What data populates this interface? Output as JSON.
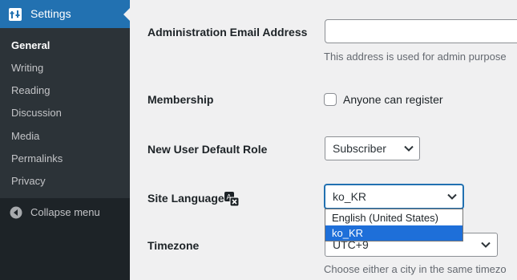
{
  "sidebar": {
    "menu_title": "Settings",
    "items": [
      {
        "label": "General",
        "current": true
      },
      {
        "label": "Writing"
      },
      {
        "label": "Reading"
      },
      {
        "label": "Discussion"
      },
      {
        "label": "Media"
      },
      {
        "label": "Permalinks"
      },
      {
        "label": "Privacy"
      }
    ],
    "collapse_label": "Collapse menu"
  },
  "form": {
    "admin_email": {
      "label": "Administration Email Address",
      "value": "",
      "description": "This address is used for admin purpose"
    },
    "membership": {
      "label": "Membership",
      "checkbox_label": "Anyone can register",
      "checked": false
    },
    "default_role": {
      "label": "New User Default Role",
      "selected": "Subscriber"
    },
    "site_language": {
      "label": "Site Language",
      "selected": "ko_KR",
      "options": [
        "English (United States)",
        "ko_KR"
      ],
      "highlighted": "ko_KR"
    },
    "timezone": {
      "label": "Timezone",
      "selected": "UTC+9",
      "description": "Choose either a city in the same timezo"
    }
  },
  "colors": {
    "accent": "#2271b1",
    "sidebar_bg": "#1d2327",
    "submenu_bg": "#2c3338",
    "option_highlight": "#1e6fd9"
  }
}
